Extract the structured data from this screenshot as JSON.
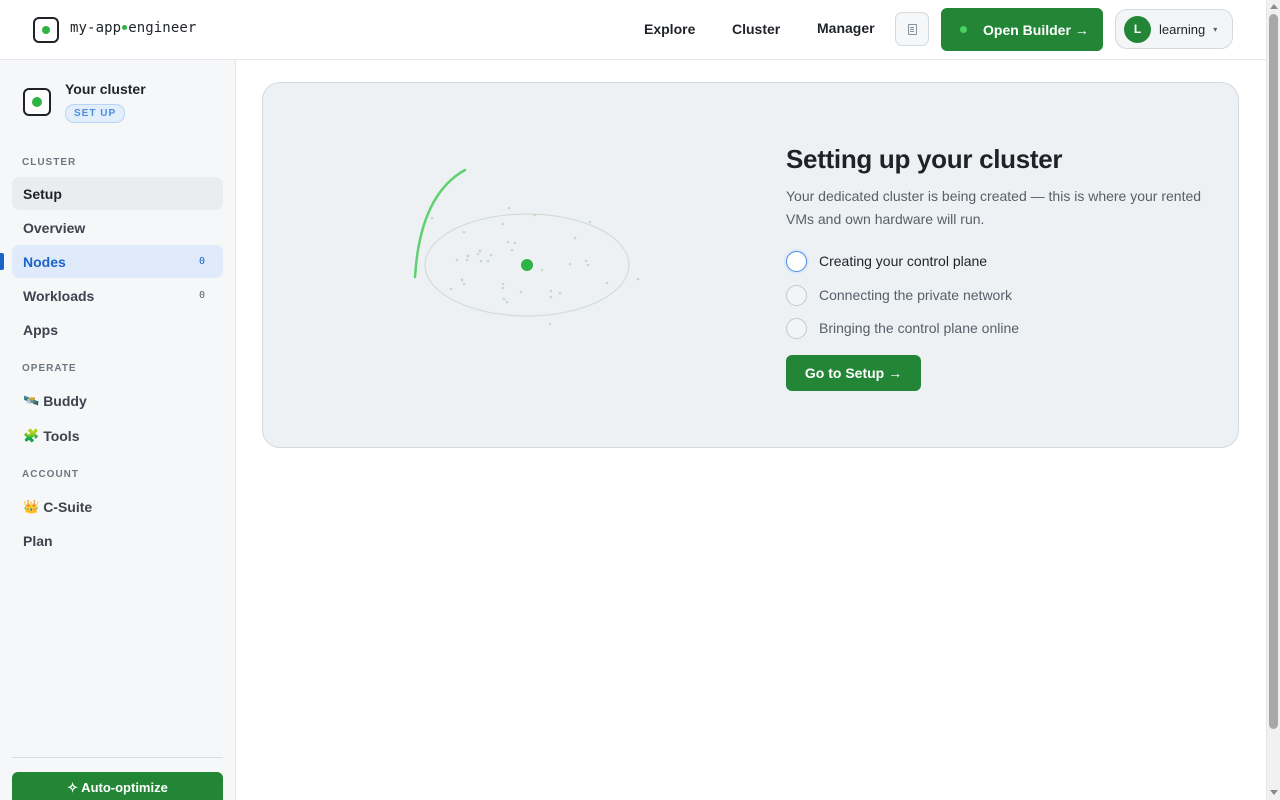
{
  "header": {
    "brand_left": "my-app",
    "brand_right": "engineer",
    "nav": [
      {
        "label": "Explore"
      },
      {
        "label": "Cluster"
      },
      {
        "label": "Manager"
      }
    ],
    "doc_icon": "document-icon",
    "builder_label": "Open Builder →",
    "user": {
      "initial": "L",
      "name": "learning",
      "caret": "▾"
    }
  },
  "sidebar": {
    "cluster_title": "Your cluster",
    "cluster_badge": "SET UP",
    "sections": {
      "cluster": "CLUSTER",
      "operate": "OPERATE",
      "account": "ACCOUNT"
    },
    "items": {
      "setup": {
        "label": "Setup"
      },
      "overview": {
        "label": "Overview"
      },
      "nodes": {
        "label": "Nodes",
        "count": "0"
      },
      "workloads": {
        "label": "Workloads",
        "count": "0"
      },
      "apps": {
        "label": "Apps"
      },
      "buddy": {
        "emoji": "🛰️",
        "label": "Buddy"
      },
      "tools": {
        "emoji": "🧩",
        "label": "Tools"
      },
      "csuite": {
        "emoji": "👑",
        "label": "C-Suite"
      },
      "plan": {
        "label": "Plan"
      }
    },
    "auto_optimize_label": "✧ Auto-optimize"
  },
  "main": {
    "title": "Setting up your cluster",
    "description": "Your dedicated cluster is being created — this is where your rented VMs and own hardware will run.",
    "steps": [
      {
        "label": "Creating your control plane",
        "state": "current"
      },
      {
        "label": "Connecting the private network",
        "state": "pending"
      },
      {
        "label": "Bringing the control plane online",
        "state": "pending"
      }
    ],
    "go_button": "Go to Setup →"
  },
  "colors": {
    "accent_green": "#238636",
    "active_blue": "#1a63c9",
    "status_dot": "#2fb344"
  }
}
